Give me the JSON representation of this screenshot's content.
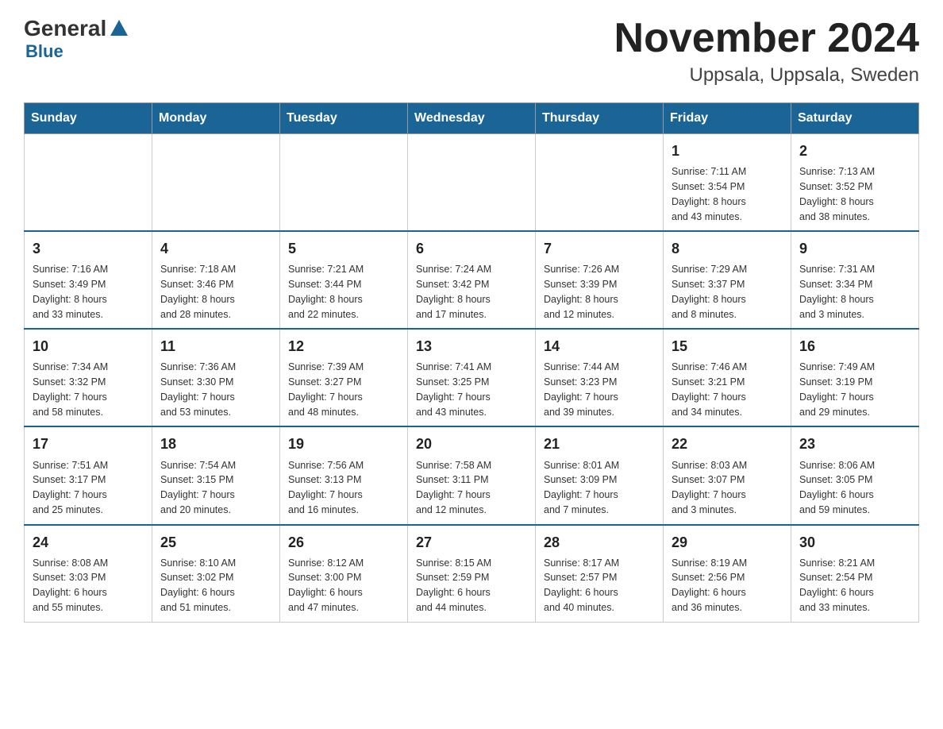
{
  "header": {
    "logo_general": "General",
    "logo_blue": "Blue",
    "month_title": "November 2024",
    "location": "Uppsala, Uppsala, Sweden"
  },
  "weekdays": [
    "Sunday",
    "Monday",
    "Tuesday",
    "Wednesday",
    "Thursday",
    "Friday",
    "Saturday"
  ],
  "weeks": [
    [
      {
        "day": "",
        "info": ""
      },
      {
        "day": "",
        "info": ""
      },
      {
        "day": "",
        "info": ""
      },
      {
        "day": "",
        "info": ""
      },
      {
        "day": "",
        "info": ""
      },
      {
        "day": "1",
        "info": "Sunrise: 7:11 AM\nSunset: 3:54 PM\nDaylight: 8 hours\nand 43 minutes."
      },
      {
        "day": "2",
        "info": "Sunrise: 7:13 AM\nSunset: 3:52 PM\nDaylight: 8 hours\nand 38 minutes."
      }
    ],
    [
      {
        "day": "3",
        "info": "Sunrise: 7:16 AM\nSunset: 3:49 PM\nDaylight: 8 hours\nand 33 minutes."
      },
      {
        "day": "4",
        "info": "Sunrise: 7:18 AM\nSunset: 3:46 PM\nDaylight: 8 hours\nand 28 minutes."
      },
      {
        "day": "5",
        "info": "Sunrise: 7:21 AM\nSunset: 3:44 PM\nDaylight: 8 hours\nand 22 minutes."
      },
      {
        "day": "6",
        "info": "Sunrise: 7:24 AM\nSunset: 3:42 PM\nDaylight: 8 hours\nand 17 minutes."
      },
      {
        "day": "7",
        "info": "Sunrise: 7:26 AM\nSunset: 3:39 PM\nDaylight: 8 hours\nand 12 minutes."
      },
      {
        "day": "8",
        "info": "Sunrise: 7:29 AM\nSunset: 3:37 PM\nDaylight: 8 hours\nand 8 minutes."
      },
      {
        "day": "9",
        "info": "Sunrise: 7:31 AM\nSunset: 3:34 PM\nDaylight: 8 hours\nand 3 minutes."
      }
    ],
    [
      {
        "day": "10",
        "info": "Sunrise: 7:34 AM\nSunset: 3:32 PM\nDaylight: 7 hours\nand 58 minutes."
      },
      {
        "day": "11",
        "info": "Sunrise: 7:36 AM\nSunset: 3:30 PM\nDaylight: 7 hours\nand 53 minutes."
      },
      {
        "day": "12",
        "info": "Sunrise: 7:39 AM\nSunset: 3:27 PM\nDaylight: 7 hours\nand 48 minutes."
      },
      {
        "day": "13",
        "info": "Sunrise: 7:41 AM\nSunset: 3:25 PM\nDaylight: 7 hours\nand 43 minutes."
      },
      {
        "day": "14",
        "info": "Sunrise: 7:44 AM\nSunset: 3:23 PM\nDaylight: 7 hours\nand 39 minutes."
      },
      {
        "day": "15",
        "info": "Sunrise: 7:46 AM\nSunset: 3:21 PM\nDaylight: 7 hours\nand 34 minutes."
      },
      {
        "day": "16",
        "info": "Sunrise: 7:49 AM\nSunset: 3:19 PM\nDaylight: 7 hours\nand 29 minutes."
      }
    ],
    [
      {
        "day": "17",
        "info": "Sunrise: 7:51 AM\nSunset: 3:17 PM\nDaylight: 7 hours\nand 25 minutes."
      },
      {
        "day": "18",
        "info": "Sunrise: 7:54 AM\nSunset: 3:15 PM\nDaylight: 7 hours\nand 20 minutes."
      },
      {
        "day": "19",
        "info": "Sunrise: 7:56 AM\nSunset: 3:13 PM\nDaylight: 7 hours\nand 16 minutes."
      },
      {
        "day": "20",
        "info": "Sunrise: 7:58 AM\nSunset: 3:11 PM\nDaylight: 7 hours\nand 12 minutes."
      },
      {
        "day": "21",
        "info": "Sunrise: 8:01 AM\nSunset: 3:09 PM\nDaylight: 7 hours\nand 7 minutes."
      },
      {
        "day": "22",
        "info": "Sunrise: 8:03 AM\nSunset: 3:07 PM\nDaylight: 7 hours\nand 3 minutes."
      },
      {
        "day": "23",
        "info": "Sunrise: 8:06 AM\nSunset: 3:05 PM\nDaylight: 6 hours\nand 59 minutes."
      }
    ],
    [
      {
        "day": "24",
        "info": "Sunrise: 8:08 AM\nSunset: 3:03 PM\nDaylight: 6 hours\nand 55 minutes."
      },
      {
        "day": "25",
        "info": "Sunrise: 8:10 AM\nSunset: 3:02 PM\nDaylight: 6 hours\nand 51 minutes."
      },
      {
        "day": "26",
        "info": "Sunrise: 8:12 AM\nSunset: 3:00 PM\nDaylight: 6 hours\nand 47 minutes."
      },
      {
        "day": "27",
        "info": "Sunrise: 8:15 AM\nSunset: 2:59 PM\nDaylight: 6 hours\nand 44 minutes."
      },
      {
        "day": "28",
        "info": "Sunrise: 8:17 AM\nSunset: 2:57 PM\nDaylight: 6 hours\nand 40 minutes."
      },
      {
        "day": "29",
        "info": "Sunrise: 8:19 AM\nSunset: 2:56 PM\nDaylight: 6 hours\nand 36 minutes."
      },
      {
        "day": "30",
        "info": "Sunrise: 8:21 AM\nSunset: 2:54 PM\nDaylight: 6 hours\nand 33 minutes."
      }
    ]
  ]
}
